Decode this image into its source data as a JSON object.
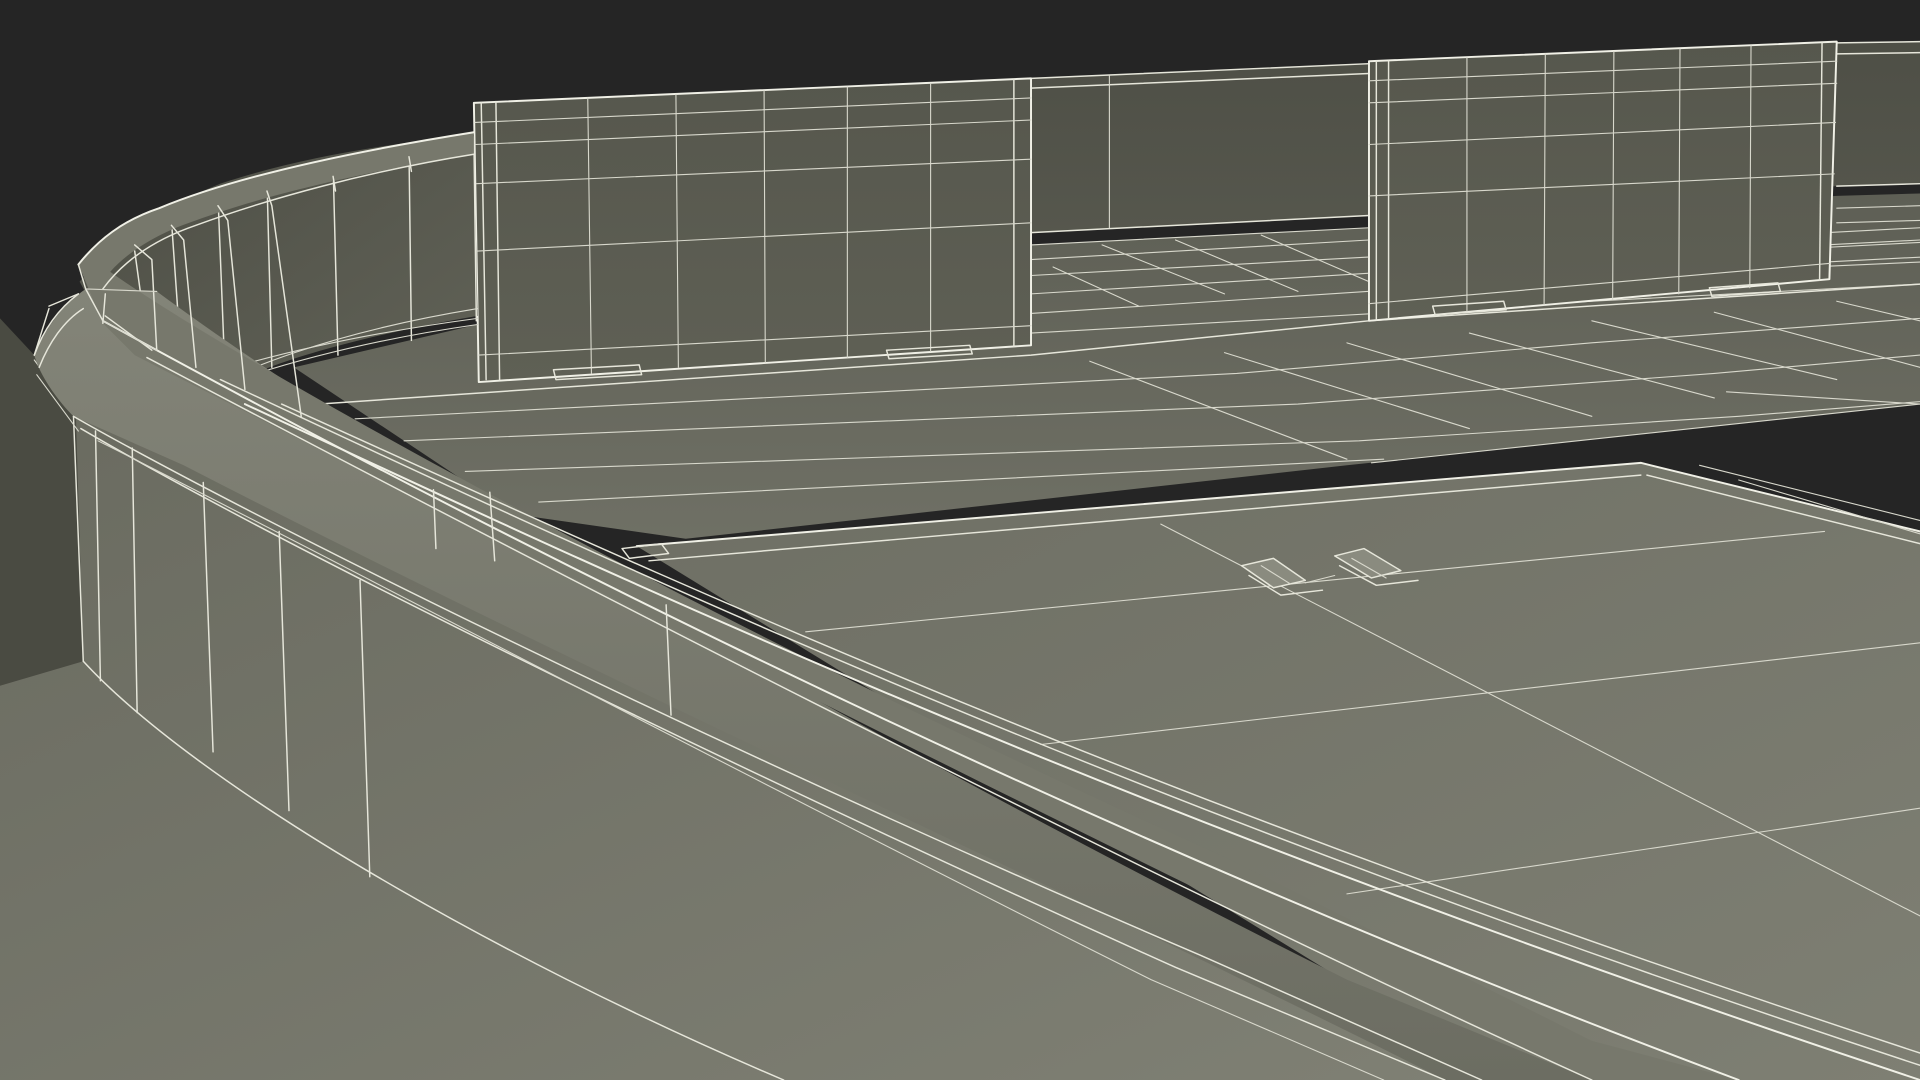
{
  "scene": {
    "background_color": "#252525",
    "surface_color": "#7a7b6f",
    "wall_color": "#55564c",
    "wireframe_color": "#e6e6da"
  }
}
